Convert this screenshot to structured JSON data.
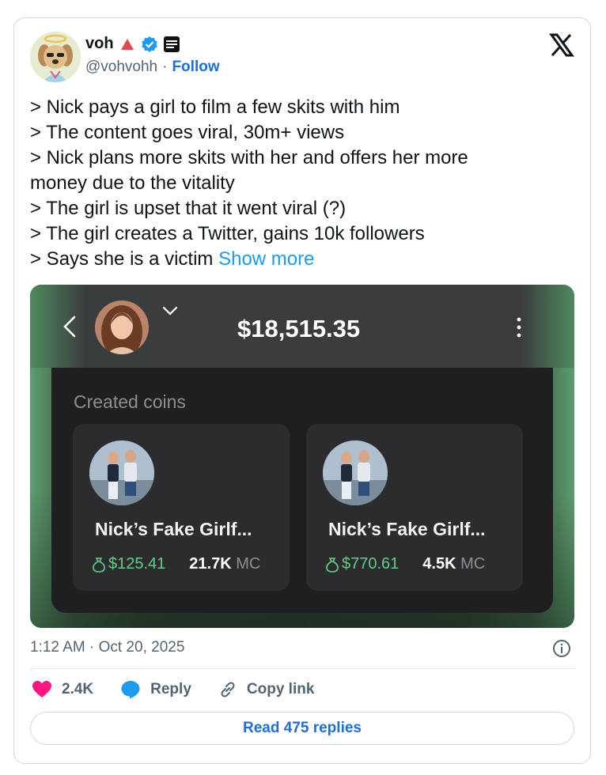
{
  "author": {
    "name": "voh",
    "handle": "@vohvohh",
    "separator": "·",
    "follow_label": "Follow",
    "badge_text": "Ava Labs"
  },
  "tweet": {
    "lines": [
      "> Nick pays a girl to film a few skits with him",
      "> The content goes viral, 30m+ views",
      "> Nick plans more skits with her and offers her more",
      "money due to the vitality",
      "> The girl is upset that it went viral (?)",
      "> The girl creates a Twitter, gains 10k followers",
      "> Says she is a victim"
    ],
    "show_more": "Show more"
  },
  "media": {
    "balance": "$18,515.35",
    "section_title": "Created coins",
    "coins": [
      {
        "name": "Nick’s Fake Girlf...",
        "price": "$125.41",
        "mc_value": "21.7K",
        "mc_unit": "MC"
      },
      {
        "name": "Nick’s Fake Girlf...",
        "price": "$770.61",
        "mc_value": "4.5K",
        "mc_unit": "MC"
      }
    ]
  },
  "meta": {
    "timestamp": "1:12 AM · Oct 20, 2025"
  },
  "actions": {
    "likes": "2.4K",
    "reply_label": "Reply",
    "copy_label": "Copy link"
  },
  "replies_button": "Read 475 replies",
  "colors": {
    "accent_blue": "#1d6fd6",
    "show_more_blue": "#1d9bf0",
    "like_red": "#f91880",
    "price_green": "#5fce87"
  },
  "icons": [
    "halo-dog-avatar",
    "red-triangle-icon",
    "verified-badge-icon",
    "ava-labs-badge-icon",
    "x-logo-icon",
    "back-chevron-icon",
    "chevron-down-icon",
    "kebab-menu-icon",
    "money-bag-icon",
    "info-icon",
    "heart-icon",
    "reply-bubble-icon",
    "link-icon"
  ]
}
